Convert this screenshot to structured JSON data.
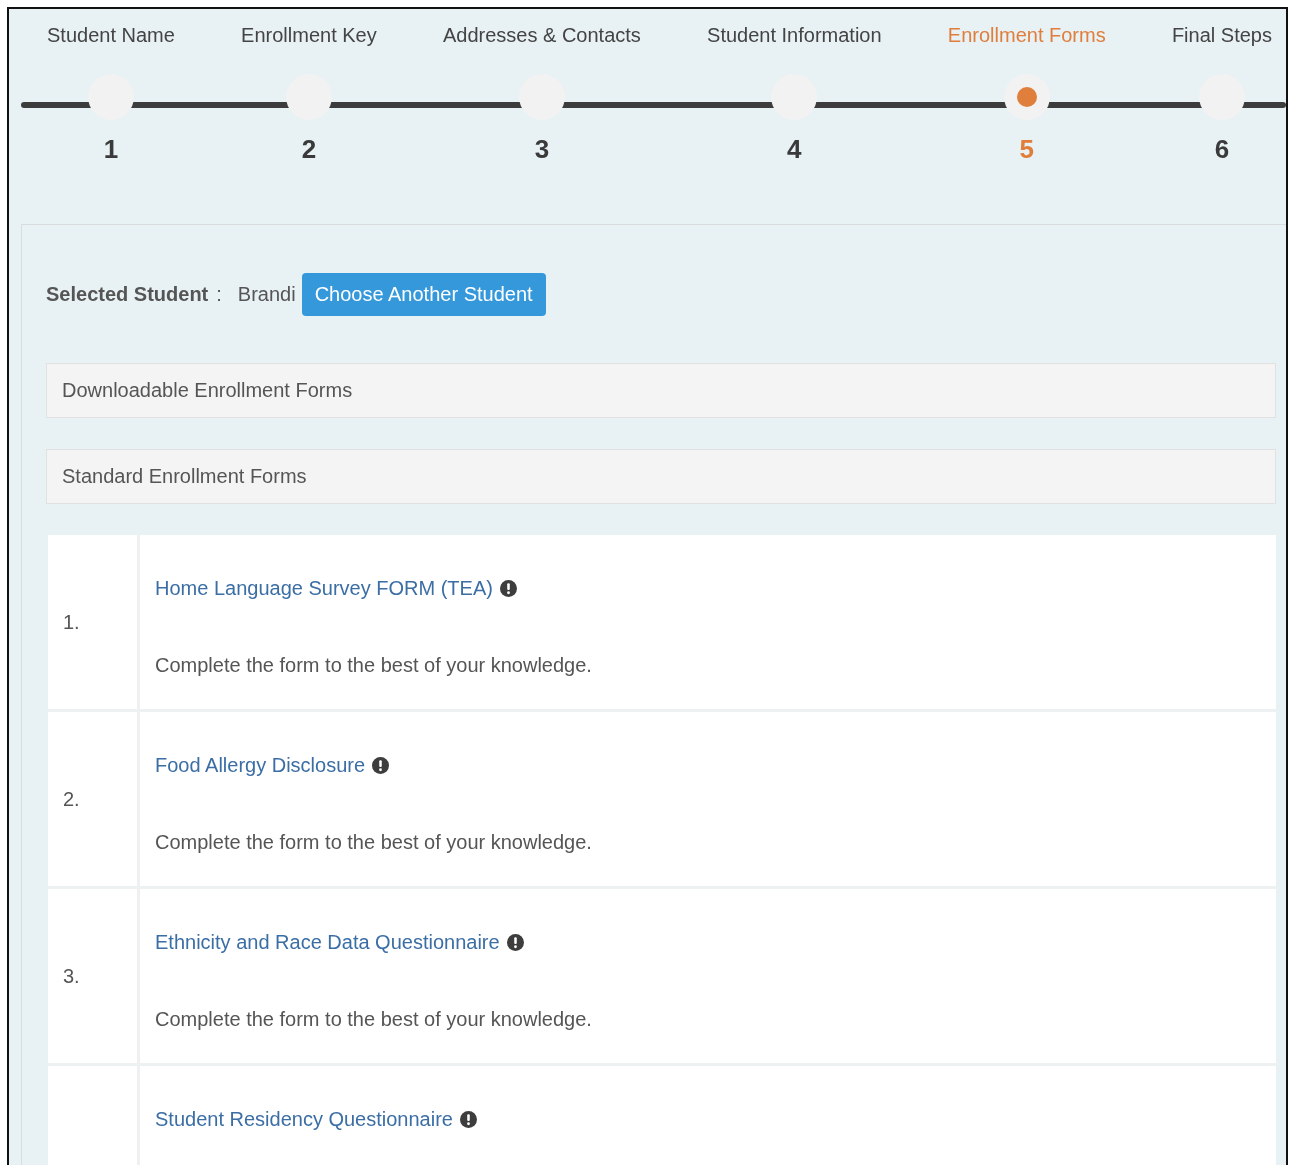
{
  "steps": [
    {
      "label": "Student Name",
      "number": "1",
      "selected": false
    },
    {
      "label": "Enrollment Key",
      "number": "2",
      "selected": false
    },
    {
      "label": "Addresses & Contacts",
      "number": "3",
      "selected": false
    },
    {
      "label": "Student Information",
      "number": "4",
      "selected": false
    },
    {
      "label": "Enrollment Forms",
      "number": "5",
      "selected": true
    },
    {
      "label": "Final Steps",
      "number": "6",
      "selected": false
    }
  ],
  "selected_student": {
    "label": "Selected Student",
    "separator": ":",
    "name": "Brandi",
    "button": "Choose Another Student"
  },
  "sections": [
    "Downloadable Enrollment Forms",
    "Standard Enrollment Forms"
  ],
  "forms": [
    {
      "number": "1.",
      "title": "Home Language Survey FORM (TEA)",
      "description": "Complete the form to the best of your knowledge."
    },
    {
      "number": "2.",
      "title": "Food Allergy Disclosure",
      "description": "Complete the form to the best of your knowledge."
    },
    {
      "number": "3.",
      "title": "Ethnicity and Race Data Questionnaire",
      "description": "Complete the form to the best of your knowledge."
    },
    {
      "title": "Student Residency Questionnaire"
    }
  ]
}
